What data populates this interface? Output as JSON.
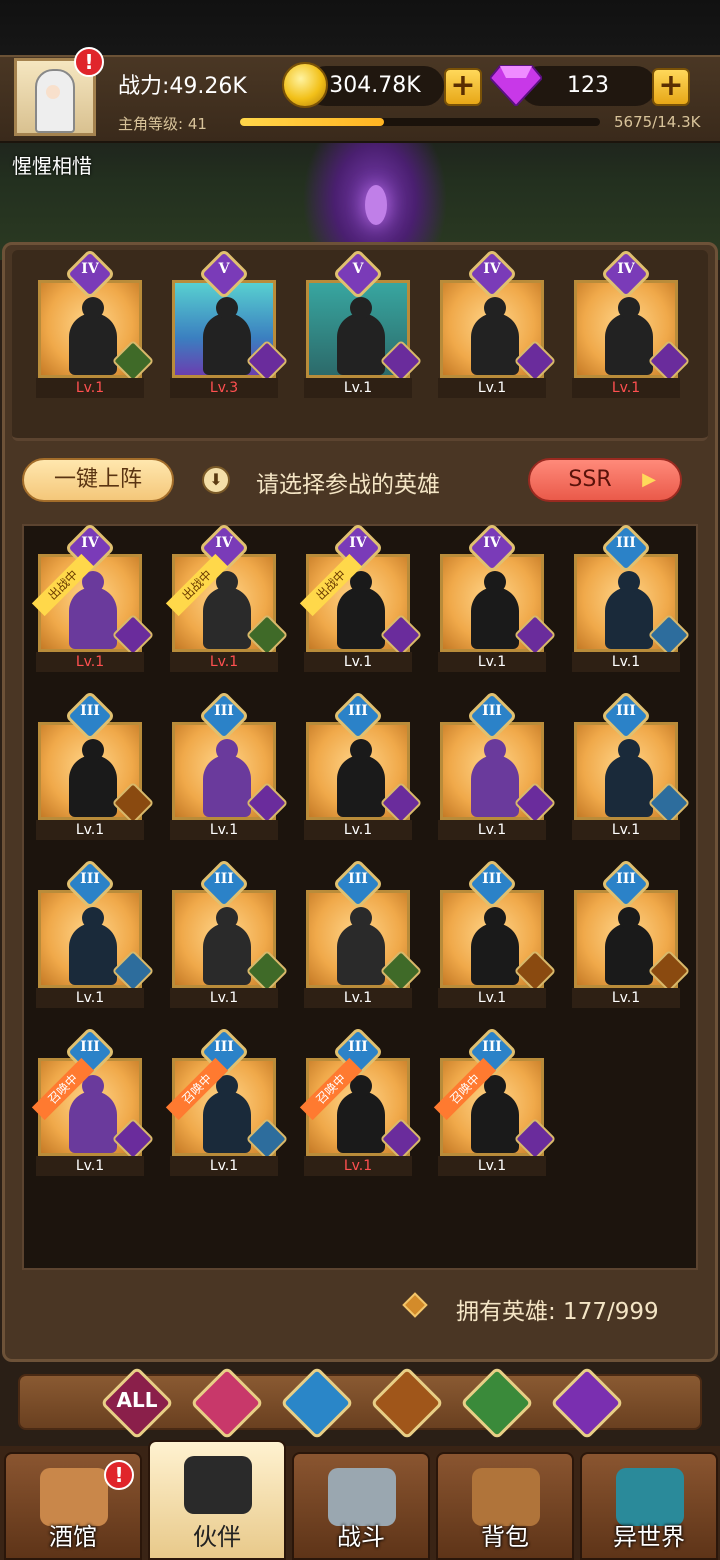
{
  "header": {
    "power_label": "战力:49.26K",
    "level_label": "主角等级: 41",
    "exp_progress": 0.4,
    "exp_text": "5675/14.3K",
    "gold_amount": "304.78K",
    "gem_amount": "123",
    "plus_symbol": "+",
    "alert_symbol": "!",
    "player_name": "惺惺相惜"
  },
  "lineup": [
    {
      "rank": "IV",
      "level": "Lv.1",
      "level_red": true,
      "faction": "elf-icon",
      "bg": "orange"
    },
    {
      "rank": "V",
      "level": "Lv.3",
      "level_red": true,
      "faction": "demon-icon",
      "bg": "teal"
    },
    {
      "rank": "V",
      "level": "Lv.1",
      "level_red": false,
      "faction": "demon-icon",
      "bg": "dark"
    },
    {
      "rank": "IV",
      "level": "Lv.1",
      "level_red": false,
      "faction": "helm-icon",
      "bg": "orange"
    },
    {
      "rank": "IV",
      "level": "Lv.1",
      "level_red": true,
      "faction": "demon-icon",
      "bg": "orange"
    }
  ],
  "controls": {
    "auto_deploy": "一键上阵",
    "hint_text": "请选择参战的英雄",
    "ssr_filter": "SSR",
    "owned_label": "拥有英雄: 177/999"
  },
  "roster": [
    {
      "rank": "IV",
      "level": "Lv.1",
      "red": true,
      "status": "出战中",
      "faction": "demon"
    },
    {
      "rank": "IV",
      "level": "Lv.1",
      "red": true,
      "status": "出战中",
      "faction": "elf"
    },
    {
      "rank": "IV",
      "level": "Lv.1",
      "red": false,
      "status": "出战中",
      "faction": "helm"
    },
    {
      "rank": "IV",
      "level": "Lv.1",
      "red": false,
      "status": "",
      "faction": "helm"
    },
    {
      "rank": "III",
      "level": "Lv.1",
      "red": false,
      "status": "",
      "faction": "blue"
    },
    {
      "rank": "III",
      "level": "Lv.1",
      "red": false,
      "status": "",
      "faction": "lion"
    },
    {
      "rank": "III",
      "level": "Lv.1",
      "red": false,
      "status": "",
      "faction": "demon"
    },
    {
      "rank": "III",
      "level": "Lv.1",
      "red": false,
      "status": "",
      "faction": "helm"
    },
    {
      "rank": "III",
      "level": "Lv.1",
      "red": false,
      "status": "",
      "faction": "demon"
    },
    {
      "rank": "III",
      "level": "Lv.1",
      "red": false,
      "status": "",
      "faction": "blue"
    },
    {
      "rank": "III",
      "level": "Lv.1",
      "red": false,
      "status": "",
      "faction": "blue"
    },
    {
      "rank": "III",
      "level": "Lv.1",
      "red": false,
      "status": "",
      "faction": "elf"
    },
    {
      "rank": "III",
      "level": "Lv.1",
      "red": false,
      "status": "",
      "faction": "elf"
    },
    {
      "rank": "III",
      "level": "Lv.1",
      "red": false,
      "status": "",
      "faction": "lion"
    },
    {
      "rank": "III",
      "level": "Lv.1",
      "red": false,
      "status": "",
      "faction": "lion"
    },
    {
      "rank": "III",
      "level": "Lv.1",
      "red": false,
      "status": "召唤中",
      "faction": "demon"
    },
    {
      "rank": "III",
      "level": "Lv.1",
      "red": false,
      "status": "召唤中",
      "faction": "blue"
    },
    {
      "rank": "III",
      "level": "Lv.1",
      "red": true,
      "status": "召唤中",
      "faction": "helm"
    },
    {
      "rank": "III",
      "level": "Lv.1",
      "red": false,
      "status": "召唤中",
      "faction": "helm"
    }
  ],
  "filters": [
    {
      "label": "ALL",
      "name": "filter-all",
      "color": "#8a1f4a"
    },
    {
      "label": "",
      "name": "filter-helm-faction",
      "color": "#c8386a"
    },
    {
      "label": "",
      "name": "filter-blue-faction",
      "color": "#2a86c8"
    },
    {
      "label": "",
      "name": "filter-lion-faction",
      "color": "#a0561a"
    },
    {
      "label": "",
      "name": "filter-elf-faction",
      "color": "#3a8a3a"
    },
    {
      "label": "",
      "name": "filter-demon-faction",
      "color": "#7a2fb0"
    }
  ],
  "nav": [
    {
      "label": "酒馆",
      "icon": "tavern-icon",
      "active": false
    },
    {
      "label": "伙伴",
      "icon": "partner-icon",
      "active": true
    },
    {
      "label": "战斗",
      "icon": "battle-icon",
      "active": false
    },
    {
      "label": "背包",
      "icon": "bag-icon",
      "active": false
    },
    {
      "label": "异世界",
      "icon": "portal-icon",
      "active": false
    }
  ]
}
